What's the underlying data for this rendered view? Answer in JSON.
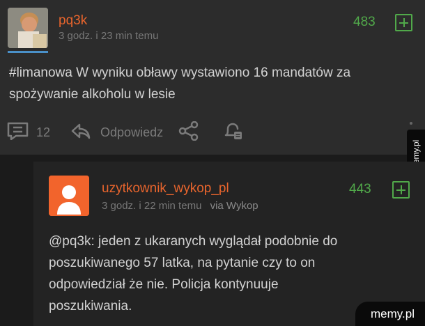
{
  "post": {
    "author": "pq3k",
    "time": "3 godz. i 23 min temu",
    "score": "483",
    "tag": "#limanowa",
    "text_line1": " W wyniku obławy wystawiono 16 mandatów za",
    "text_line2": "spożywanie alkoholu w lesie",
    "comments_count": "12",
    "reply_label": "Odpowiedz"
  },
  "reply": {
    "author": "uzytkownik_wykop_pl",
    "time": "3 godz. i 22 min temu",
    "via": "via Wykop",
    "score": "443",
    "mention": "@pq3k",
    "line1_rest": ": jeden z ukaranych wyglądał podobnie do",
    "line2": "poszukiwanego 57 latka, na pytanie czy to on",
    "line3": "odpowiedział że nie. Policja kontynuuje",
    "line4": "poszukiwania."
  },
  "watermark": {
    "side": "memy.pl",
    "bottom": "memy.pl"
  },
  "colors": {
    "accent_orange": "#e9652d",
    "score_green": "#51a94a",
    "avatar_orange": "#f2642c"
  },
  "icons": [
    "comment-icon",
    "reply-icon",
    "share-icon",
    "notification-icon",
    "plus-icon",
    "more-icon"
  ]
}
